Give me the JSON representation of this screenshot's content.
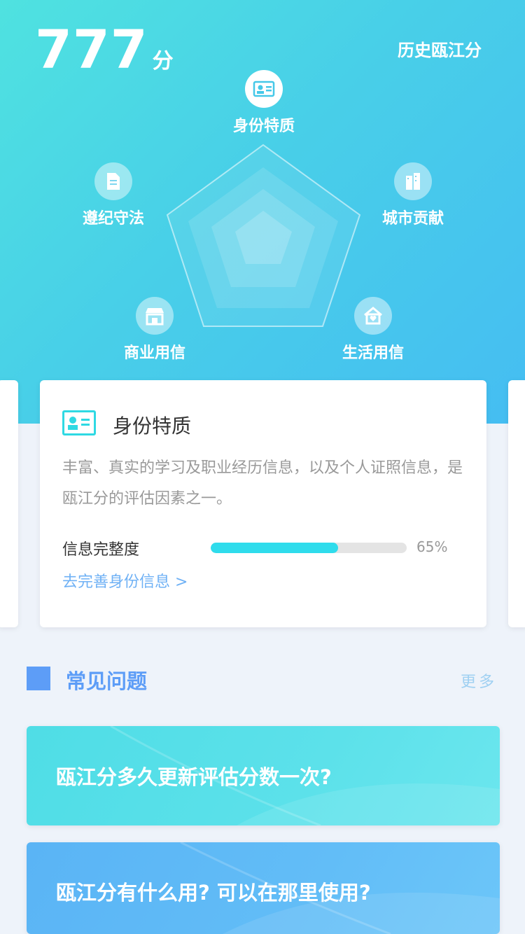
{
  "header": {
    "score": "777",
    "score_unit": "分",
    "history_label": "历史瓯江分"
  },
  "dimensions": [
    {
      "label": "身份特质",
      "icon": "id-card-icon"
    },
    {
      "label": "城市贡献",
      "icon": "building-icon"
    },
    {
      "label": "生活用信",
      "icon": "home-heart-icon"
    },
    {
      "label": "商业用信",
      "icon": "shop-icon"
    },
    {
      "label": "遵纪守法",
      "icon": "document-icon"
    }
  ],
  "card": {
    "title": "身份特质",
    "description": "丰富、真实的学习及职业经历信息，以及个人证照信息，是瓯江分的评估因素之一。",
    "progress_label": "信息完整度",
    "progress_value": 0.65,
    "progress_text": "65%",
    "link_text": "去完善身份信息 >"
  },
  "faq": {
    "title": "常见问题",
    "more": "更多",
    "items": [
      "瓯江分多久更新评估分数一次?",
      "瓯江分有什么用? 可以在那里使用?"
    ]
  },
  "colors": {
    "accent": "#2fdcec",
    "blue": "#5d9df7",
    "link": "#6fb1f5"
  }
}
